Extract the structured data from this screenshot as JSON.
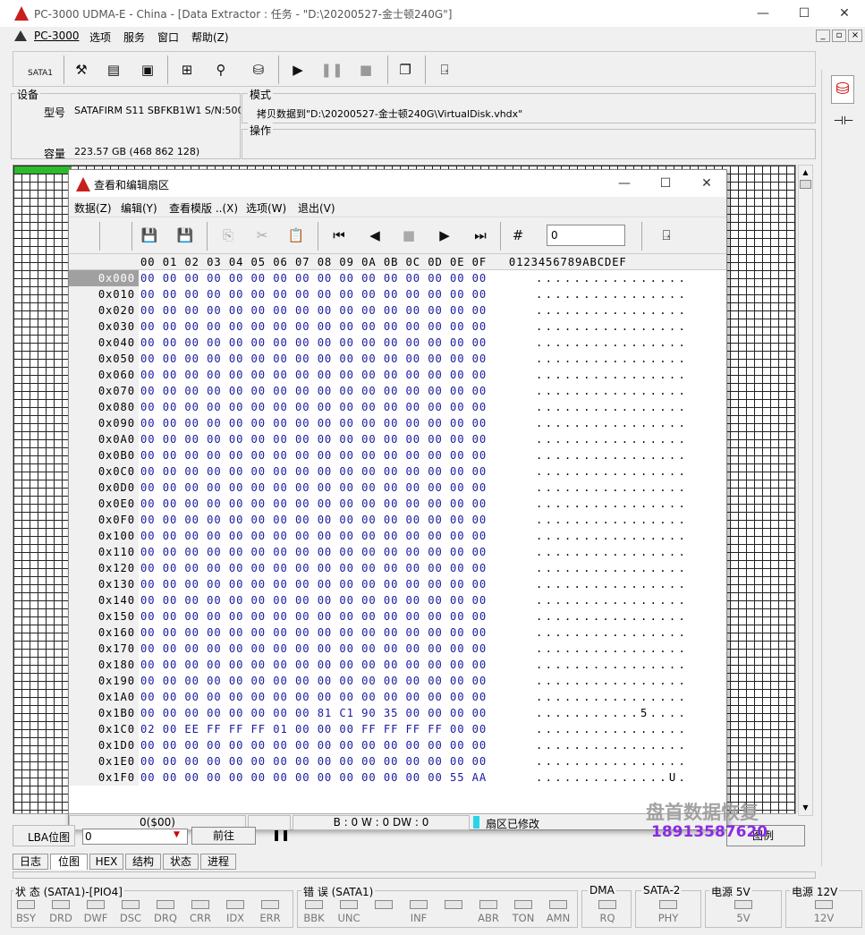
{
  "window": {
    "title": "PC-3000 UDMA-E - China - [Data Extractor : 任务 - \"D:\\20200527-金士顿240G\"]",
    "min": "—",
    "max": "☐",
    "close": "✕"
  },
  "menu": [
    {
      "label": "PC-3000"
    },
    {
      "label": "选项"
    },
    {
      "label": "服务"
    },
    {
      "label": "窗口"
    },
    {
      "label": "帮助(Z)"
    }
  ],
  "mdi_controls": [
    "_",
    "▫",
    "×"
  ],
  "toolbar": {
    "sata_label": "SATA1"
  },
  "device": {
    "group_label": "设备",
    "model_label": "型号",
    "model_value": "SATAFIRM   S11 SBFKB1W1 S/N:500",
    "capacity_label": "容量",
    "capacity_value": "223.57 GB (468 862 128)"
  },
  "mode": {
    "group_label": "模式",
    "value": "拷贝数据到\"D:\\20200527-金士顿240G\\VirtualDisk.vhdx\""
  },
  "operation": {
    "group_label": "操作"
  },
  "dialog": {
    "title": "查看和编辑扇区",
    "menu": [
      "数据(Z)",
      "编辑(Y)",
      "查看模版 ..(X)",
      "选项(W)",
      "退出(V)"
    ],
    "input_value": "0",
    "header": "00 01 02 03 04 05 06 07 08 09 0A 0B 0C 0D 0E 0F   0123456789ABCDEF",
    "offsets": [
      "0x000",
      "0x010",
      "0x020",
      "0x030",
      "0x040",
      "0x050",
      "0x060",
      "0x070",
      "0x080",
      "0x090",
      "0x0A0",
      "0x0B0",
      "0x0C0",
      "0x0D0",
      "0x0E0",
      "0x0F0",
      "0x100",
      "0x110",
      "0x120",
      "0x130",
      "0x140",
      "0x150",
      "0x160",
      "0x170",
      "0x180",
      "0x190",
      "0x1A0",
      "0x1B0",
      "0x1C0",
      "0x1D0",
      "0x1E0",
      "0x1F0"
    ],
    "rows": [
      "00 00 00 00 00 00 00 00 00 00 00 00 00 00 00 00",
      "00 00 00 00 00 00 00 00 00 00 00 00 00 00 00 00",
      "00 00 00 00 00 00 00 00 00 00 00 00 00 00 00 00",
      "00 00 00 00 00 00 00 00 00 00 00 00 00 00 00 00",
      "00 00 00 00 00 00 00 00 00 00 00 00 00 00 00 00",
      "00 00 00 00 00 00 00 00 00 00 00 00 00 00 00 00",
      "00 00 00 00 00 00 00 00 00 00 00 00 00 00 00 00",
      "00 00 00 00 00 00 00 00 00 00 00 00 00 00 00 00",
      "00 00 00 00 00 00 00 00 00 00 00 00 00 00 00 00",
      "00 00 00 00 00 00 00 00 00 00 00 00 00 00 00 00",
      "00 00 00 00 00 00 00 00 00 00 00 00 00 00 00 00",
      "00 00 00 00 00 00 00 00 00 00 00 00 00 00 00 00",
      "00 00 00 00 00 00 00 00 00 00 00 00 00 00 00 00",
      "00 00 00 00 00 00 00 00 00 00 00 00 00 00 00 00",
      "00 00 00 00 00 00 00 00 00 00 00 00 00 00 00 00",
      "00 00 00 00 00 00 00 00 00 00 00 00 00 00 00 00",
      "00 00 00 00 00 00 00 00 00 00 00 00 00 00 00 00",
      "00 00 00 00 00 00 00 00 00 00 00 00 00 00 00 00",
      "00 00 00 00 00 00 00 00 00 00 00 00 00 00 00 00",
      "00 00 00 00 00 00 00 00 00 00 00 00 00 00 00 00",
      "00 00 00 00 00 00 00 00 00 00 00 00 00 00 00 00",
      "00 00 00 00 00 00 00 00 00 00 00 00 00 00 00 00",
      "00 00 00 00 00 00 00 00 00 00 00 00 00 00 00 00",
      "00 00 00 00 00 00 00 00 00 00 00 00 00 00 00 00",
      "00 00 00 00 00 00 00 00 00 00 00 00 00 00 00 00",
      "00 00 00 00 00 00 00 00 00 00 00 00 00 00 00 00",
      "00 00 00 00 00 00 00 00 00 00 00 00 00 00 00 00",
      "00 00 00 00 00 00 00 00 81 C1 90 35 00 00 00 00",
      "02 00 EE FF FF FF 01 00 00 00 FF FF FF FF 00 00",
      "00 00 00 00 00 00 00 00 00 00 00 00 00 00 00 00",
      "00 00 00 00 00 00 00 00 00 00 00 00 00 00 00 00",
      "00 00 00 00 00 00 00 00 00 00 00 00 00 00 55 AA"
    ],
    "ascii": [
      "................",
      "................",
      "................",
      "................",
      "................",
      "................",
      "................",
      "................",
      "................",
      "................",
      "................",
      "................",
      "................",
      "................",
      "................",
      "................",
      "................",
      "................",
      "................",
      "................",
      "................",
      "................",
      "................",
      "................",
      "................",
      "................",
      "................",
      "...........5....",
      "................",
      "................",
      "................",
      "..............U."
    ],
    "status": {
      "pos": "0($00)",
      "bwd": "B : 0 W : 0 DW : 0",
      "modified": "扇区已修改"
    }
  },
  "lba": {
    "label": "LBA位图",
    "value": "0",
    "forward_button": "前往",
    "legend_button": "图例"
  },
  "tabs": [
    "日志",
    "位图",
    "HEX",
    "结构",
    "状态",
    "进程"
  ],
  "status_panels": {
    "state": {
      "label": "状 态 (SATA1)-[PIO4]",
      "leds": [
        "BSY",
        "DRD",
        "DWF",
        "DSC",
        "DRQ",
        "CRR",
        "IDX",
        "ERR"
      ]
    },
    "error": {
      "label": "错 误 (SATA1)",
      "leds": [
        "BBK",
        "UNC",
        "",
        "INF",
        "",
        "ABR",
        "TON",
        "AMN"
      ]
    },
    "dma": {
      "label": "DMA",
      "leds": [
        "RQ"
      ]
    },
    "sata2": {
      "label": "SATA-2",
      "leds": [
        "PHY"
      ]
    },
    "p5": {
      "label": "电源 5V",
      "leds": [
        "5V"
      ]
    },
    "p12": {
      "label": "电源 12V",
      "leds": [
        "12V"
      ]
    }
  },
  "watermark": {
    "line1": "盘首数据恢复",
    "line2": "18913587620"
  }
}
